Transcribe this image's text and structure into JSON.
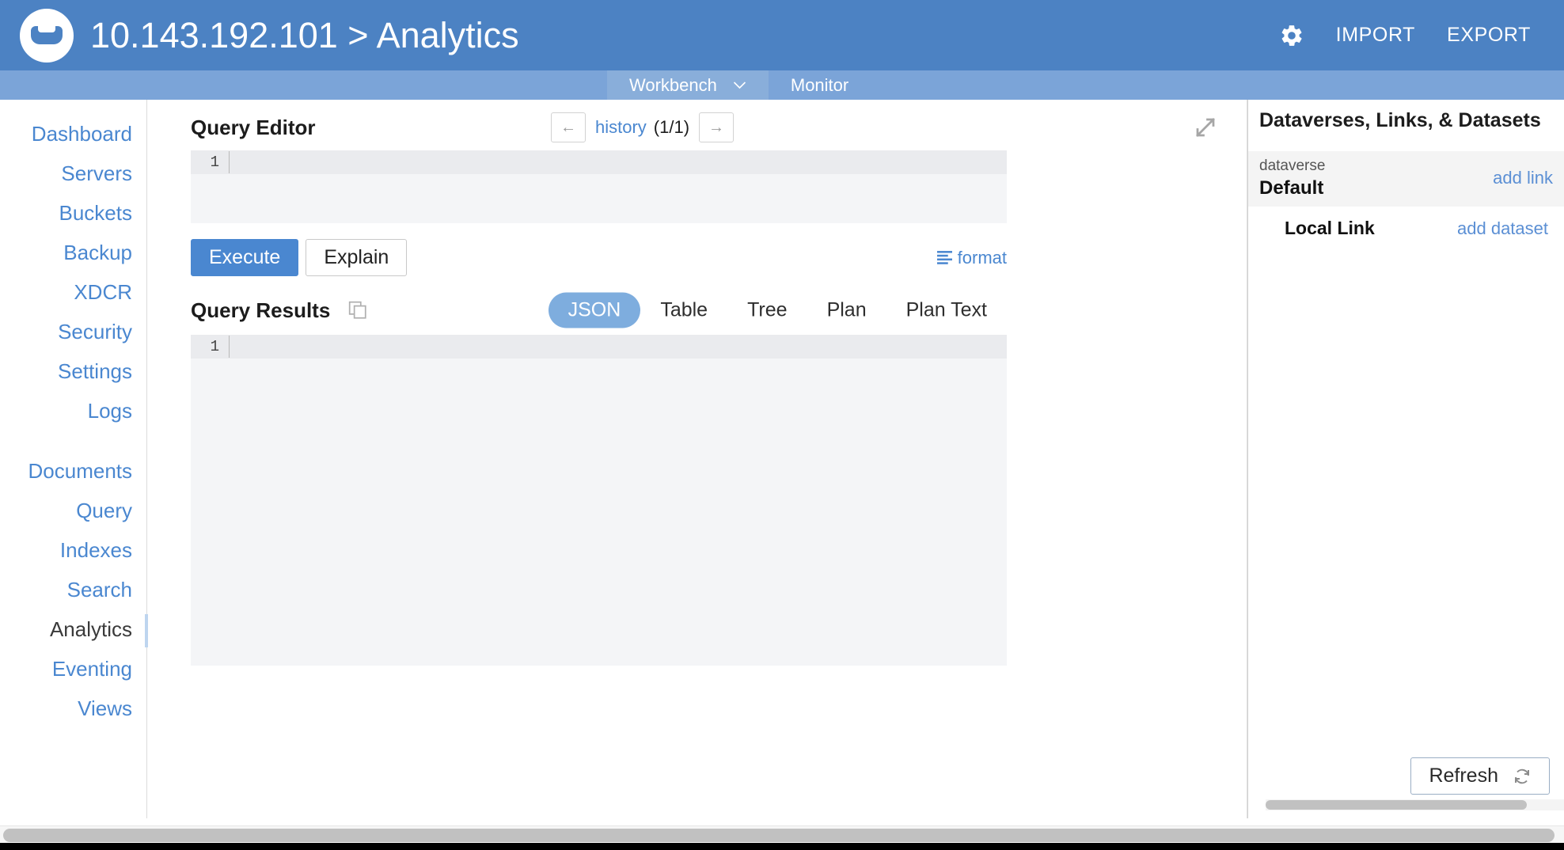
{
  "header": {
    "logo_name": "couchbase-logo",
    "title": "10.143.192.101 > Analytics",
    "gear_label": "settings-gear",
    "import_label": "IMPORT",
    "export_label": "EXPORT",
    "bg_color": "#4c82c3"
  },
  "subnav": {
    "tabs": [
      {
        "label": "Workbench",
        "active": true,
        "has_chevron": true
      },
      {
        "label": "Monitor",
        "active": false,
        "has_chevron": false
      }
    ],
    "bg_color": "#7ba4d8",
    "active_bg_color": "#89aeda"
  },
  "sidebar": {
    "group1": [
      {
        "label": "Dashboard"
      },
      {
        "label": "Servers"
      },
      {
        "label": "Buckets"
      },
      {
        "label": "Backup"
      },
      {
        "label": "XDCR"
      },
      {
        "label": "Security"
      },
      {
        "label": "Settings"
      },
      {
        "label": "Logs"
      }
    ],
    "group2": [
      {
        "label": "Documents"
      },
      {
        "label": "Query"
      },
      {
        "label": "Indexes"
      },
      {
        "label": "Search"
      },
      {
        "label": "Analytics"
      },
      {
        "label": "Eventing"
      },
      {
        "label": "Views"
      }
    ],
    "active_item": "Analytics",
    "link_color": "#4a87d0",
    "active_color": "#3a3a3a",
    "active_indicator_color": "#bed5ef"
  },
  "query_editor": {
    "title": "Query Editor",
    "prev_arrow": "←",
    "history_label": "history",
    "history_count": "(1/1)",
    "next_arrow": "→",
    "expand_icon_name": "expand-arrows-icon",
    "line_number": "1",
    "content": "",
    "execute_label": "Execute",
    "explain_label": "Explain",
    "format_label": "format",
    "primary_color": "#4a87d0"
  },
  "query_results": {
    "title": "Query Results",
    "copy_icon_name": "copy-icon",
    "tabs": [
      {
        "label": "JSON",
        "active": true
      },
      {
        "label": "Table",
        "active": false
      },
      {
        "label": "Tree",
        "active": false
      },
      {
        "label": "Plan",
        "active": false
      },
      {
        "label": "Plan Text",
        "active": false
      }
    ],
    "line_number": "1",
    "content": "",
    "active_tab_color": "#7eadde"
  },
  "right_panel": {
    "title": "Dataverses, Links, & Datasets",
    "dataverse_label": "dataverse",
    "dataverse_name": "Default",
    "add_link_label": "add link",
    "link_name": "Local Link",
    "add_dataset_label": "add dataset",
    "refresh_label": "Refresh",
    "refresh_icon_name": "refresh-icon"
  }
}
